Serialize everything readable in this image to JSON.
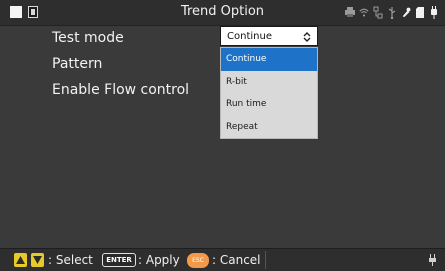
{
  "window": {
    "title": "Trend Option"
  },
  "status_icons": [
    "printer-icon",
    "wifi-icon",
    "network-icon",
    "usb-icon",
    "tool-icon",
    "sd-card-icon",
    "power-plug-icon"
  ],
  "settings": {
    "rows": [
      {
        "label": "Test mode"
      },
      {
        "label": "Pattern"
      },
      {
        "label": "Enable Flow control"
      }
    ]
  },
  "test_mode_select": {
    "value": "Continue",
    "options": [
      "Continue",
      "R-bit",
      "Run time",
      "Repeat"
    ],
    "selected_index": 0
  },
  "footer": {
    "select_label": ": Select",
    "enter_key": "ENTER",
    "apply_label": ": Apply",
    "esc_key": "ESC",
    "cancel_label": ": Cancel"
  },
  "colors": {
    "accent": "#1e73c8",
    "arrow_keys": "#e8c92a",
    "esc_key": "#f39a4a"
  }
}
